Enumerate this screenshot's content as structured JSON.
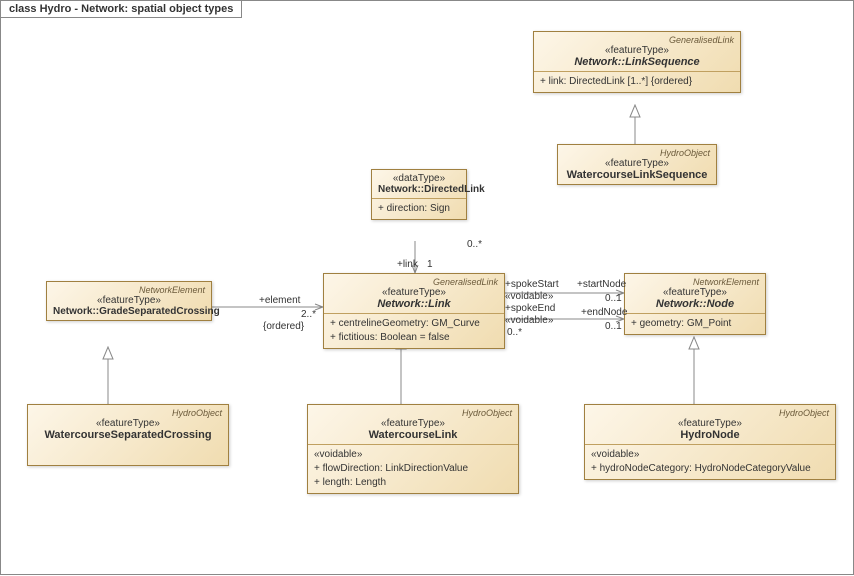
{
  "frame_title": "class Hydro - Network: spatial object types",
  "boxes": {
    "linkseq": {
      "tag": "GeneralisedLink",
      "stereo": "«featureType»",
      "name": "Network::LinkSequence",
      "name_it": true,
      "attrs": [
        "+   link: DirectedLink [1..*] {ordered}"
      ]
    },
    "wcls": {
      "tag": "HydroObject",
      "stereo": "«featureType»",
      "name": "WatercourseLinkSequence",
      "name_it": false
    },
    "dlink": {
      "tag": "",
      "stereo": "«dataType»",
      "name": "Network::DirectedLink",
      "name_it": false,
      "nm2": "",
      "attrs": [
        "+   direction: Sign"
      ]
    },
    "netlink": {
      "tag": "GeneralisedLink",
      "stereo": "«featureType»",
      "name": "Network::Link",
      "name_it": true,
      "attrs": [
        "+   centrelineGeometry: GM_Curve",
        "+   fictitious: Boolean = false"
      ]
    },
    "node": {
      "tag": "NetworkElement",
      "stereo": "«featureType»",
      "name": "Network::Node",
      "name_it": true,
      "attrs": [
        "+   geometry: GM_Point"
      ]
    },
    "gsc": {
      "tag": "NetworkElement",
      "stereo": "«featureType»",
      "name": "Network::GradeSeparatedCrossing",
      "name_it": false
    },
    "wcsc": {
      "tag": "HydroObject",
      "stereo": "«featureType»",
      "name": "WatercourseSeparatedCrossing",
      "name_it": false
    },
    "wcl": {
      "tag": "HydroObject",
      "stereo": "«featureType»",
      "name": "WatercourseLink",
      "name_it": false,
      "voidable": "«voidable»",
      "attrs": [
        "+   flowDirection: LinkDirectionValue",
        "+   length: Length"
      ]
    },
    "hn": {
      "tag": "HydroObject",
      "stereo": "«featureType»",
      "name": "HydroNode",
      "name_it": false,
      "voidable": "«voidable»",
      "attrs": [
        "+   hydroNodeCategory: HydroNodeCategoryValue"
      ]
    }
  },
  "labels": {
    "elem": "+element",
    "elem_m": "2..*",
    "elem_o": "{ordered}",
    "link": "+link",
    "link_m1": "1",
    "link_m0": "0..*",
    "spokeS": "+spokeStart",
    "spokeE": "+spokeEnd",
    "void": "«voidable»",
    "zerostar": "0..*",
    "startN": "+startNode",
    "endN": "+endNode",
    "zeroone": "0..1"
  }
}
